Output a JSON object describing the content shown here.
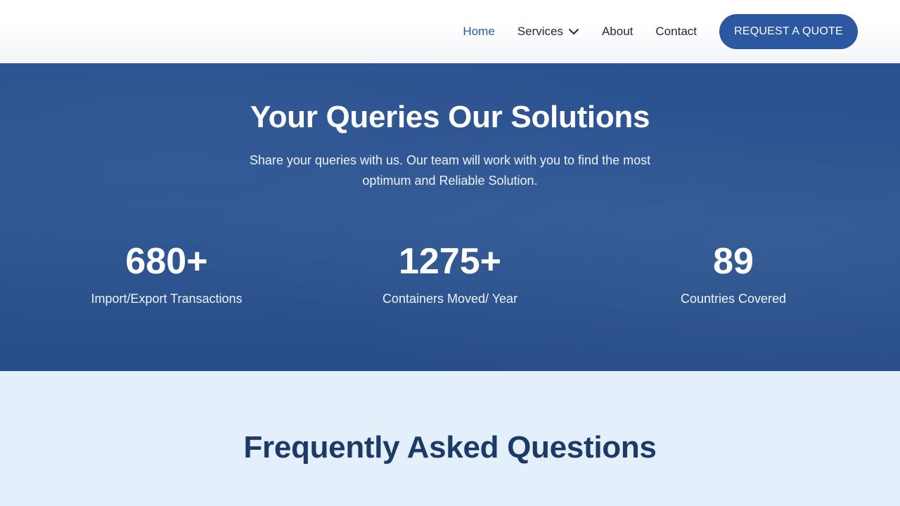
{
  "nav": {
    "items": [
      {
        "label": "Home",
        "active": true
      },
      {
        "label": "Services",
        "has_dropdown": true,
        "icon": "chevron-down-icon"
      },
      {
        "label": "About"
      },
      {
        "label": "Contact"
      }
    ],
    "cta_label": "REQUEST A QUOTE"
  },
  "hero": {
    "title": "Your Queries Our Solutions",
    "description": "Share your queries with us. Our team will work with you to find the most optimum and Reliable Solution.",
    "stats": [
      {
        "value": "680+",
        "label": "Import/Export Transactions"
      },
      {
        "value": "1275+",
        "label": "Containers Moved/ Year"
      },
      {
        "value": "89",
        "label": "Countries Covered"
      }
    ]
  },
  "faq": {
    "title": "Frequently Asked Questions"
  },
  "colors": {
    "brand_blue": "#2b58a0",
    "hero_bg": "#2c5592",
    "faq_bg": "#e3f0fc",
    "faq_title": "#1d3a66",
    "nav_text": "#1f2937"
  }
}
